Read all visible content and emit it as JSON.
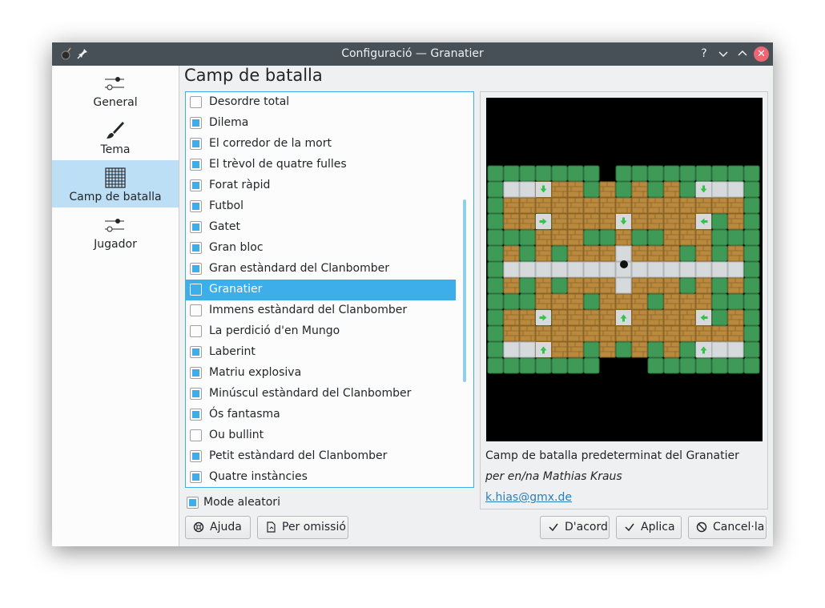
{
  "window": {
    "title": "Configuració — Granatier"
  },
  "sidebar": {
    "items": [
      {
        "label": "General",
        "icon": "general-settings-icon"
      },
      {
        "label": "Tema",
        "icon": "paintbrush-icon"
      },
      {
        "label": "Camp de batalla",
        "icon": "grid-icon",
        "active": true
      },
      {
        "label": "Jugador",
        "icon": "player-settings-icon"
      }
    ]
  },
  "page": {
    "heading": "Camp de batalla"
  },
  "arena_list": {
    "items": [
      {
        "label": "Desordre total",
        "checked": false
      },
      {
        "label": "Dilema",
        "checked": true
      },
      {
        "label": "El corredor de la mort",
        "checked": true
      },
      {
        "label": "El trèvol de quatre fulles",
        "checked": true
      },
      {
        "label": "Forat ràpid",
        "checked": true
      },
      {
        "label": "Futbol",
        "checked": true
      },
      {
        "label": "Gatet",
        "checked": true
      },
      {
        "label": "Gran bloc",
        "checked": true
      },
      {
        "label": "Gran estàndard del Clanbomber",
        "checked": true
      },
      {
        "label": "Granatier",
        "checked": false,
        "selected": true
      },
      {
        "label": "Immens estàndard del Clanbomber",
        "checked": false
      },
      {
        "label": "La perdició d'en Mungo",
        "checked": false
      },
      {
        "label": "Laberint",
        "checked": true
      },
      {
        "label": "Matriu explosiva",
        "checked": true
      },
      {
        "label": "Minúscul estàndard del Clanbomber",
        "checked": true
      },
      {
        "label": "Ós fantasma",
        "checked": true
      },
      {
        "label": "Ou bullint",
        "checked": false
      },
      {
        "label": "Petit estàndard del Clanbomber",
        "checked": true
      },
      {
        "label": "Quatre instàncies",
        "checked": true
      }
    ]
  },
  "random_mode": {
    "label": "Mode aleatori",
    "checked": true
  },
  "preview": {
    "description": "Camp de batalla predeterminat del Granatier",
    "author": "per en/na Mathias Kraus",
    "email": "k.hias@gmx.de"
  },
  "buttons": {
    "help": "Ajuda",
    "defaults": "Per omissió",
    "ok": "D'acord",
    "apply": "Aplica",
    "cancel": "Cancel·la"
  },
  "colors": {
    "accent": "#3daee9",
    "titlebar": "#475057",
    "close": "#ed6672"
  }
}
